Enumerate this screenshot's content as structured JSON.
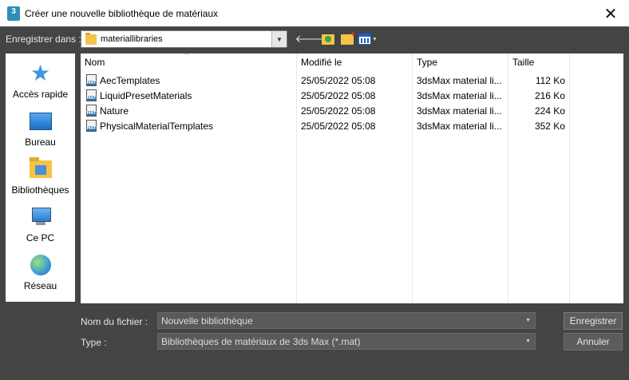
{
  "window": {
    "app_icon_text": "3",
    "title": "Créer une nouvelle bibliothèque de matériaux",
    "close_glyph": "✕"
  },
  "save_in": {
    "label": "Enregistrer dans :",
    "location": "materiallibraries",
    "back_glyph": "🡐",
    "view_caret": "▼",
    "dropdown_glyph": "▼"
  },
  "places": [
    {
      "label": "Accès rapide",
      "icon": "star-icon"
    },
    {
      "label": "Bureau",
      "icon": "desktop-icon"
    },
    {
      "label": "Bibliothèques",
      "icon": "library-icon"
    },
    {
      "label": "Ce PC",
      "icon": "pc-icon"
    },
    {
      "label": "Réseau",
      "icon": "network-icon"
    }
  ],
  "file_list": {
    "columns": [
      "Nom",
      "Modifié le",
      "Type",
      "Taille"
    ],
    "sort_indicator": "^",
    "rows": [
      {
        "name": "AecTemplates",
        "modified": "25/05/2022 05:08",
        "type": "3dsMax material li...",
        "size": "112 Ko"
      },
      {
        "name": "LiquidPresetMaterials",
        "modified": "25/05/2022 05:08",
        "type": "3dsMax material li...",
        "size": "216 Ko"
      },
      {
        "name": "Nature",
        "modified": "25/05/2022 05:08",
        "type": "3dsMax material li...",
        "size": "224 Ko"
      },
      {
        "name": "PhysicalMaterialTemplates",
        "modified": "25/05/2022 05:08",
        "type": "3dsMax material li...",
        "size": "352 Ko"
      }
    ]
  },
  "filename": {
    "label": "Nom du fichier :",
    "value": "Nouvelle bibliothèque",
    "arrow": "▼"
  },
  "filetype": {
    "label": "Type :",
    "value": "Bibliothèques de matériaux de 3ds Max (*.mat)",
    "arrow": "▼"
  },
  "buttons": {
    "save": "Enregistrer",
    "cancel": "Annuler"
  },
  "colors": {
    "dialog_bg": "#444444",
    "list_bg": "#ffffff",
    "accent": "#1b5fbf"
  }
}
